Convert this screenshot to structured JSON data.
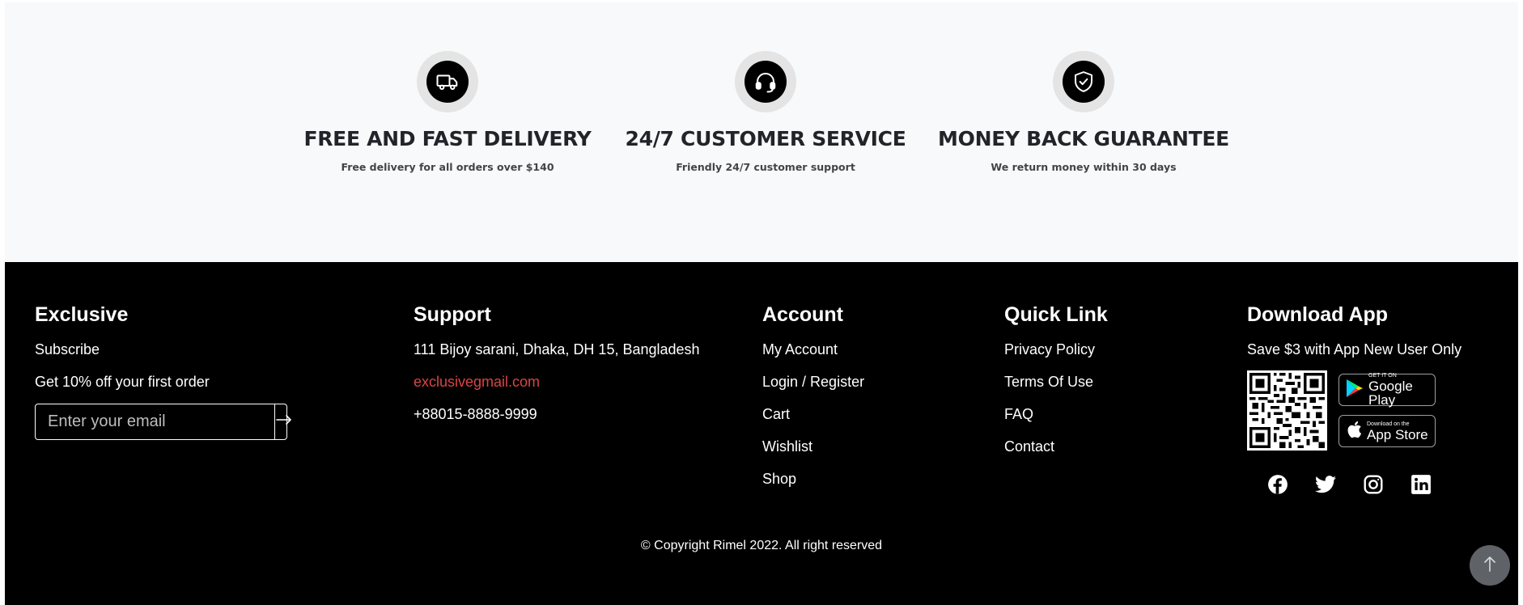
{
  "services": [
    {
      "icon": "delivery-truck-icon",
      "title": "FREE AND FAST DELIVERY",
      "subtitle": "Free delivery for all orders over $140"
    },
    {
      "icon": "headset-icon",
      "title": "24/7 CUSTOMER SERVICE",
      "subtitle": "Friendly 24/7 customer support"
    },
    {
      "icon": "shield-check-icon",
      "title": "MONEY BACK GUARANTEE",
      "subtitle": "We return money within 30 days"
    }
  ],
  "footer": {
    "exclusive": {
      "title": "Exclusive",
      "subscribe": "Subscribe",
      "offer": "Get 10% off your first order",
      "email_placeholder": "Enter your email",
      "send_icon": "arrow-right-icon"
    },
    "support": {
      "title": "Support",
      "address": "111 Bijoy sarani, Dhaka, DH 15, Bangladesh",
      "email": "exclusivegmail.com",
      "phone": "+88015-8888-9999"
    },
    "account": {
      "title": "Account",
      "links": [
        "My Account",
        "Login / Register",
        "Cart",
        "Wishlist",
        "Shop"
      ]
    },
    "quick_link": {
      "title": "Quick Link",
      "links": [
        "Privacy Policy",
        "Terms Of Use",
        "FAQ",
        "Contact"
      ]
    },
    "download_app": {
      "title": "Download App",
      "promo": "Save $3 with App New User Only",
      "google_play": {
        "small": "GET IT ON",
        "big": "Google Play"
      },
      "app_store": {
        "small": "Download on the",
        "big": "App Store"
      },
      "socials": [
        "facebook-icon",
        "twitter-icon",
        "instagram-icon",
        "linkedin-icon"
      ]
    },
    "copyright": "© Copyright Rimel 2022. All right reserved",
    "scroll_top_icon": "arrow-up-icon"
  },
  "colors": {
    "accent": "#db4444",
    "footer_bg": "#000000",
    "services_bg": "#f8f9fa"
  }
}
